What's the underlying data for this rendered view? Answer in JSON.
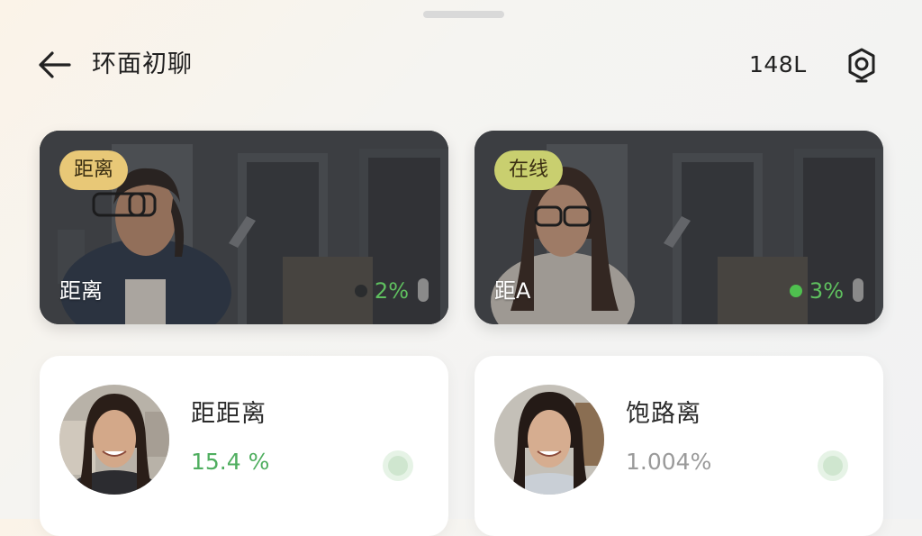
{
  "header": {
    "title": "环面初聊",
    "count": "148L",
    "back_icon": "arrow-left-icon",
    "camera_icon": "camera-icon"
  },
  "video_cards": [
    {
      "tag": "距离",
      "tag_color": "#e8c877",
      "name": "距离",
      "percent": "2%",
      "status_dot": "dim"
    },
    {
      "tag": "在线",
      "tag_color": "#c9cf6f",
      "name": "距A",
      "percent": "3%",
      "status_dot": "green"
    }
  ],
  "user_cards": [
    {
      "name": "距距离",
      "stat": "15.4 %",
      "stat_color": "#4fae5f"
    },
    {
      "name": "饱路离",
      "stat": "1.004%",
      "stat_color": "#9a9a9a"
    }
  ],
  "colors": {
    "accent_green": "#4fc04f",
    "tag_gold": "#e8c877",
    "tag_lime": "#c9cf6f"
  }
}
